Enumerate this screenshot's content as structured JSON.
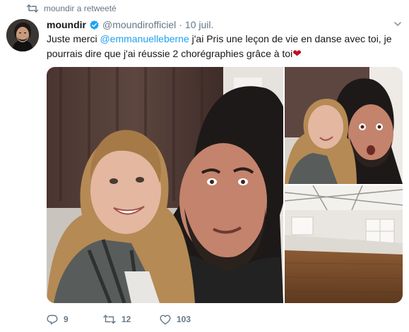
{
  "retweet": {
    "icon": "retweet-icon",
    "label": "moundir a retweeté"
  },
  "tweet": {
    "author": {
      "name": "moundir",
      "verified": true,
      "handle": "@moundirofficiel",
      "separator": "·",
      "date": "10 juil."
    },
    "text": {
      "part1": "Juste merci ",
      "mention": "@emmanuelleberne",
      "part2": " j'ai Pris une leçon de vie en danse avec toi, je pourrais dire que j'ai réussie 2 chorégraphies grâce à toi",
      "emoji": "❤"
    },
    "stats": {
      "replies": "9",
      "retweets": "12",
      "likes": "103"
    }
  },
  "colors": {
    "accent": "#1da1f2",
    "muted": "#657786",
    "text": "#14171a",
    "heart": "#c2101e"
  },
  "icons": [
    "retweet-icon",
    "verified-badge-icon",
    "chevron-down-icon",
    "reply-icon",
    "retweet-action-icon",
    "like-icon"
  ]
}
